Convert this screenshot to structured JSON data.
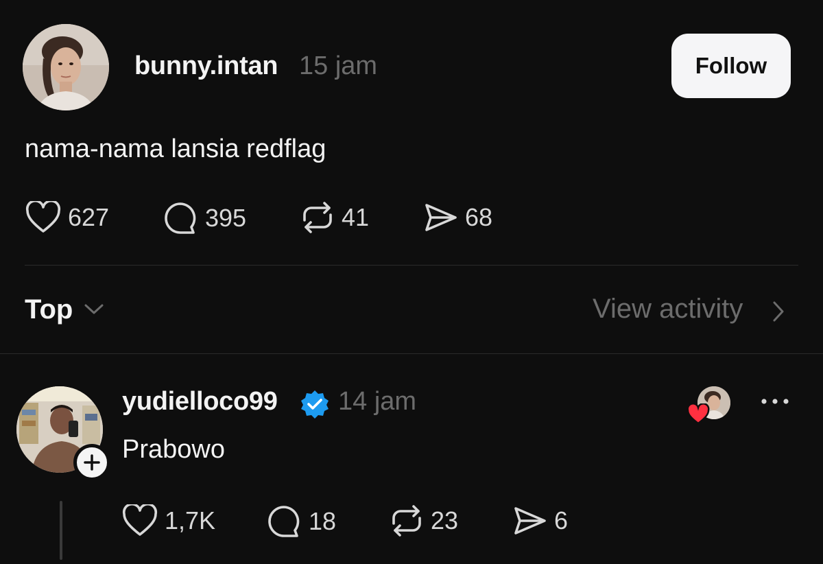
{
  "post": {
    "author": "bunny.intan",
    "time": "15 jam",
    "follow_label": "Follow",
    "text": "nama-nama lansia redflag",
    "actions": {
      "likes": "627",
      "replies": "395",
      "reposts": "41",
      "shares": "68"
    }
  },
  "sort": {
    "label": "Top",
    "view_activity": "View activity"
  },
  "reply": {
    "author": "yudielloco99",
    "verified": true,
    "time": "14 jam",
    "text": "Prabowo",
    "actions": {
      "likes": "1,7K",
      "replies": "18",
      "reposts": "23",
      "shares": "6"
    }
  },
  "icons": {
    "like": "heart-icon",
    "reply": "comment-bubble-icon",
    "repost": "repost-icon",
    "share": "send-icon",
    "verified": "verified-badge-icon",
    "more": "more-dots-icon"
  },
  "colors": {
    "background": "#0e0e0e",
    "verified": "#1d9bf0",
    "liked_heart": "#ff3040",
    "muted_text": "#6c6c6c"
  }
}
